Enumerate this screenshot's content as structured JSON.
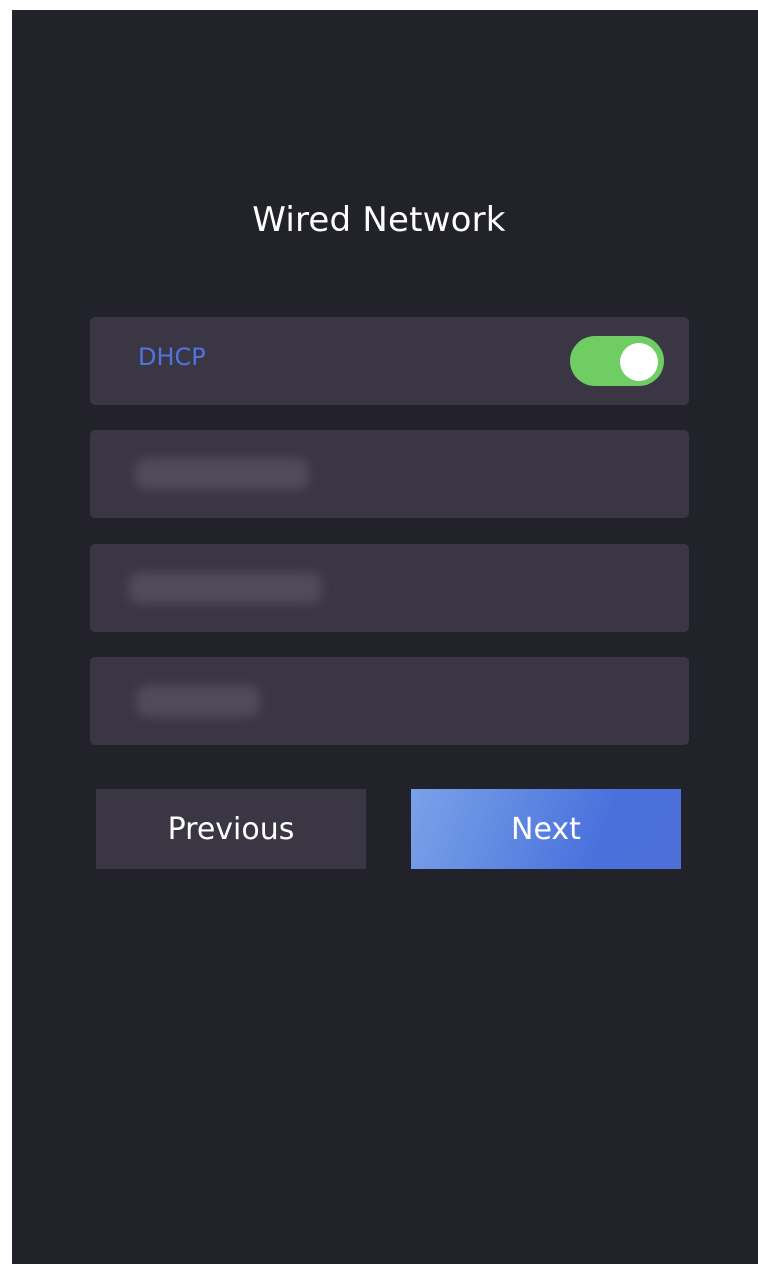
{
  "page": {
    "title": "Wired Network"
  },
  "dhcp": {
    "label": "DHCP",
    "enabled": true,
    "toggle_color": "#6fcd63",
    "label_color": "#4f74e0"
  },
  "fields": {
    "ip_address": {
      "value": ""
    },
    "subnet_mask": {
      "value": ""
    },
    "gateway": {
      "value": ""
    }
  },
  "buttons": {
    "previous_label": "Previous",
    "next_label": "Next",
    "next_color": "#5b83e0"
  }
}
